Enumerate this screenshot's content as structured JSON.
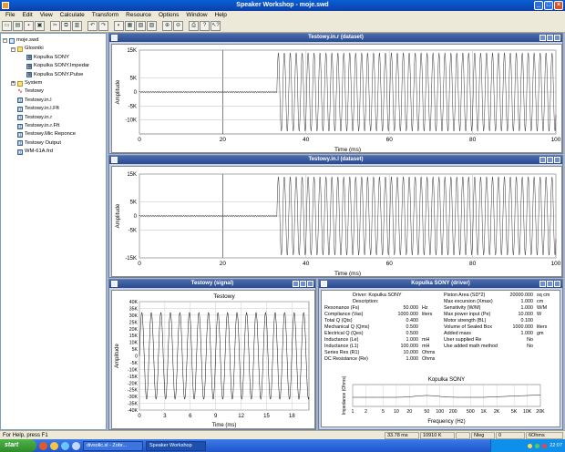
{
  "window": {
    "title": "Speaker Workshop - moje.swd"
  },
  "menu": [
    "File",
    "Edit",
    "View",
    "Calculate",
    "Transform",
    "Resource",
    "Options",
    "Window",
    "Help"
  ],
  "toolbar": [
    "new",
    "open",
    "save",
    "print-setup",
    "cut",
    "copy",
    "paste",
    "undo",
    "redo",
    "measure",
    "calc",
    "graph",
    "zoom-in",
    "zoom-out",
    "print",
    "help",
    "help-context"
  ],
  "tree": {
    "items": [
      {
        "label": "moje.swd",
        "level": 0,
        "icon": "file"
      },
      {
        "label": "Glosniki",
        "level": 1,
        "icon": "folder"
      },
      {
        "label": "Kopulka SONY",
        "level": 2,
        "icon": "doc"
      },
      {
        "label": "Kopulka SONY.Impedar",
        "level": 2,
        "icon": "doc"
      },
      {
        "label": "Kopulka SONY.Pulse",
        "level": 2,
        "icon": "doc"
      },
      {
        "label": "System",
        "level": 1,
        "icon": "folder"
      },
      {
        "label": "Testowy",
        "level": 1,
        "icon": "wave"
      },
      {
        "label": "Testowy.in.l",
        "level": 1,
        "icon": "doc"
      },
      {
        "label": "Testowy.in.l.Fft",
        "level": 1,
        "icon": "doc"
      },
      {
        "label": "Testowy.in.r",
        "level": 1,
        "icon": "doc"
      },
      {
        "label": "Testowy.in.r.Fft",
        "level": 1,
        "icon": "doc"
      },
      {
        "label": "Testowy.Mic Reponce",
        "level": 1,
        "icon": "doc"
      },
      {
        "label": "Testowy Output",
        "level": 1,
        "icon": "doc"
      },
      {
        "label": "WM-61A.frd",
        "level": 1,
        "icon": "doc"
      }
    ]
  },
  "panels": {
    "ds1": {
      "title": "Testowy.in.r (dataset)"
    },
    "ds2": {
      "title": "Testowy.in.l (dataset)"
    },
    "sig": {
      "title": "Testowy (signal)"
    },
    "drv": {
      "title": "Kopulka SONY (driver)"
    }
  },
  "chart_data": [
    {
      "type": "line",
      "ylabel": "Amplitude",
      "xlabel": "Time (ms)",
      "xlim": [
        0,
        100
      ],
      "ylim": [
        -15000,
        15000
      ],
      "x_ticks": [
        "0",
        "20",
        "40",
        "60",
        "80",
        "100"
      ],
      "y_ticks": [
        "15K",
        "5K",
        "0",
        "-5K",
        "-10K"
      ],
      "series": [
        {
          "description": "near-zero noise to ~33 ms, then sine about ±14000 to 100 ms"
        }
      ]
    },
    {
      "type": "line",
      "ylabel": "Amplitude",
      "xlabel": "Time (ms)",
      "xlim": [
        0,
        100
      ],
      "ylim": [
        -15000,
        15000
      ],
      "x_ticks": [
        "0",
        "20",
        "40",
        "60",
        "80",
        "100"
      ],
      "y_ticks": [
        "15K",
        "5K",
        "0",
        "-5K",
        "-15K"
      ]
    },
    {
      "type": "line",
      "title": "Testowy",
      "ylabel": "Amplitude",
      "xlabel": "Time (ms)",
      "xlim": [
        0,
        20
      ],
      "ylim": [
        -40000,
        40000
      ],
      "x_ticks": [
        "0",
        "3",
        "6",
        "9",
        "12",
        "15",
        "18"
      ],
      "y_ticks": [
        "40K",
        "35K",
        "30K",
        "25K",
        "20K",
        "15K",
        "10K",
        "5K",
        "0",
        "-5K",
        "-10K",
        "-15K",
        "-20K",
        "-25K",
        "-30K",
        "-35K",
        "-40K"
      ]
    },
    {
      "type": "line",
      "title": "Kopulka SONY",
      "xlabel": "Frequency (Hz)",
      "ylabel": "Impedance (Ohms)",
      "x_ticks": [
        "1",
        "2",
        "5",
        "10",
        "20",
        "50",
        "100",
        "200",
        "500",
        "1K",
        "2K",
        "5K",
        "10K",
        "20K"
      ]
    }
  ],
  "driver": {
    "left": [
      {
        "k": "Driver:",
        "v": "Kopulka SONY",
        "u": ""
      },
      {
        "k": "Description:",
        "v": "",
        "u": ""
      },
      {
        "k": "Resonance (Fs)",
        "v": "50.000",
        "u": "Hz"
      },
      {
        "k": "Compliance (Vas)",
        "v": "1000.000",
        "u": "liters"
      },
      {
        "k": "Total Q (Qts)",
        "v": "0.400",
        "u": ""
      },
      {
        "k": "Mechanical Q (Qms)",
        "v": "0.500",
        "u": ""
      },
      {
        "k": "Electrical Q (Qes)",
        "v": "0.500",
        "u": ""
      },
      {
        "k": "Inductance (Le)",
        "v": "1.000",
        "u": "mH"
      },
      {
        "k": "Inductance (L1)",
        "v": "100.000",
        "u": "mH"
      },
      {
        "k": "Series Res (R1)",
        "v": "10.000",
        "u": "Ohms"
      },
      {
        "k": "DC Resistance (Re)",
        "v": "1.000",
        "u": "Ohms"
      }
    ],
    "right": [
      {
        "k": "Piston Area (SD*2)",
        "v": "20000.000",
        "u": "sq cm"
      },
      {
        "k": "Max excursion (Xmax)",
        "v": "1.000",
        "u": "cm"
      },
      {
        "k": "Sensitivity (W/M)",
        "v": "1.000",
        "u": "W/M"
      },
      {
        "k": "Max power input (Pe)",
        "v": "10.000",
        "u": "W"
      },
      {
        "k": "Motor strength (BL)",
        "v": "0.100",
        "u": ""
      },
      {
        "k": "Volume of Sealed Box",
        "v": "1000.000",
        "u": "liters"
      },
      {
        "k": "Added mass",
        "v": "1.000",
        "u": "gm"
      },
      {
        "k": "User supplied Re",
        "v": "No",
        "u": ""
      },
      {
        "k": "Use added math method",
        "v": "No",
        "u": ""
      }
    ]
  },
  "status": {
    "help": "For Help, press F1",
    "cells": [
      "33.78 ms",
      "10910 K",
      "",
      "Nleg",
      "0",
      "6Ohms"
    ]
  },
  "taskbar": {
    "start": "start",
    "tasks": [
      "divsolic.sl - Zobr...",
      "Speaker Workshop"
    ],
    "clock": "22:07"
  },
  "colors": {
    "title": "#0b4dbf",
    "panel_title": "#2f4f93",
    "wave": "#000000",
    "status": "#ece9d8"
  }
}
